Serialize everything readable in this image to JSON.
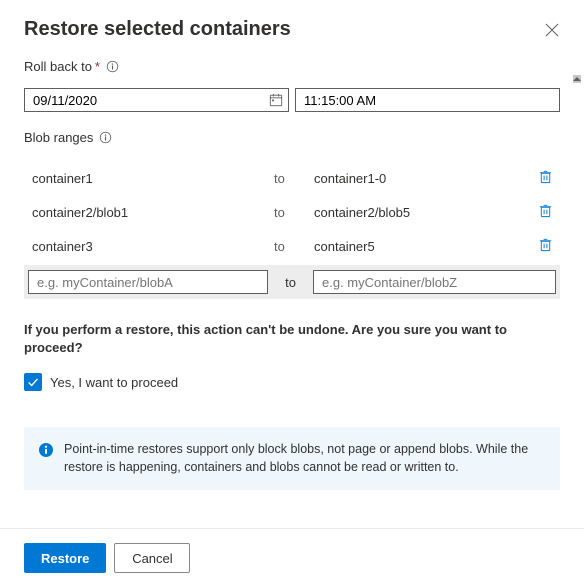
{
  "header": {
    "title": "Restore selected containers"
  },
  "rollback": {
    "label": "Roll back to",
    "date": "09/11/2020",
    "time": "11:15:00 AM"
  },
  "ranges": {
    "label": "Blob ranges",
    "to_label": "to",
    "rows": [
      {
        "from": "container1",
        "to": "container1-0"
      },
      {
        "from": "container2/blob1",
        "to": "container2/blob5"
      },
      {
        "from": "container3",
        "to": "container5"
      }
    ],
    "input": {
      "from_placeholder": "e.g. myContainer/blobA",
      "to_placeholder": "e.g. myContainer/blobZ",
      "to_label": "to"
    }
  },
  "confirm": {
    "warning": "If you perform a restore, this action can't be undone. Are you sure you want to proceed?",
    "checkbox_label": "Yes, I want to proceed",
    "checked": true
  },
  "info_box": {
    "text": "Point-in-time restores support only block blobs, not page or append blobs. While the restore is happening, containers and blobs cannot be read or written to."
  },
  "footer": {
    "primary": "Restore",
    "secondary": "Cancel"
  }
}
